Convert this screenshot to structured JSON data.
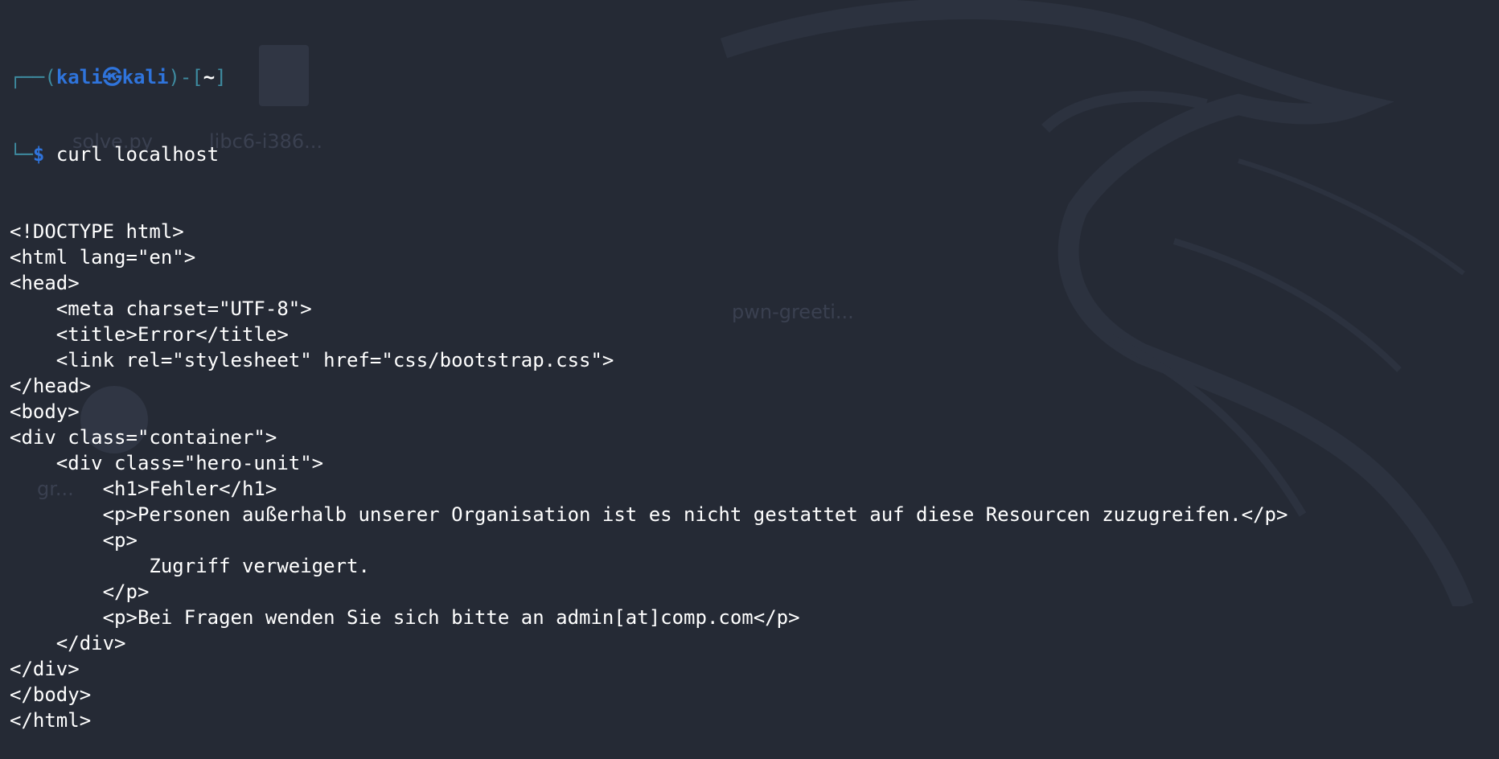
{
  "prompt": {
    "corner_top": "┌──",
    "paren_open": "(",
    "user": "kali",
    "at_symbol": "㉿",
    "host": "kali",
    "paren_close": ")",
    "dash_bracket_open": "-[",
    "cwd": "~",
    "bracket_close": "]",
    "corner_bottom": "└─",
    "dollar": "$",
    "command": "curl localhost"
  },
  "output_lines": [
    "<!DOCTYPE html>",
    "<html lang=\"en\">",
    "<head>",
    "    <meta charset=\"UTF-8\">",
    "    <title>Error</title>",
    "    <link rel=\"stylesheet\" href=\"css/bootstrap.css\">",
    "</head>",
    "<body>",
    "<div class=\"container\">",
    "    <div class=\"hero-unit\">",
    "        <h1>Fehler</h1>",
    "        <p>Personen außerhalb unserer Organisation ist es nicht gestattet auf diese Resourcen zuzugreifen.</p>",
    "        <p>",
    "            Zugriff verweigert.",
    "        </p>",
    "        <p>Bei Fragen wenden Sie sich bitte an admin[at]comp.com</p>",
    "    </div>",
    "</div>",
    "</body>",
    "</html>"
  ],
  "desktop_icons": {
    "file_1": "solve.py",
    "file_2": "libc6-i386...",
    "file_3": "pwn-greeti...",
    "file_4": "gr..."
  },
  "colors": {
    "background": "#252a35",
    "prompt_blue": "#2f74dc",
    "prompt_teal": "#3e8ba0",
    "text": "#ffffff"
  }
}
